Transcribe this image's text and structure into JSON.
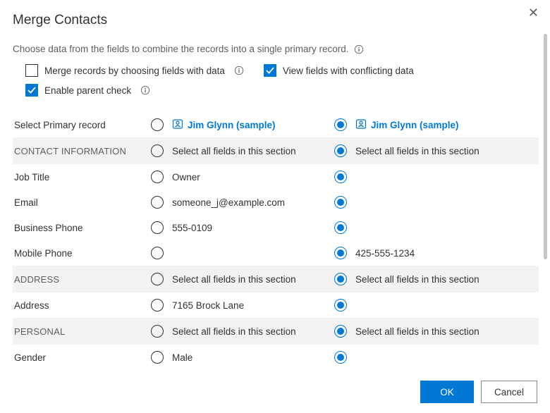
{
  "dialog": {
    "title": "Merge Contacts",
    "instruction": "Choose data from the fields to combine the records into a single primary record."
  },
  "options": {
    "mergeByFields": {
      "label": "Merge records by choosing fields with data",
      "checked": false
    },
    "viewConflicting": {
      "label": "View fields with conflicting data",
      "checked": true
    },
    "enableParent": {
      "label": "Enable parent check",
      "checked": true
    }
  },
  "primaryLabel": "Select Primary record",
  "recordA": {
    "name": "Jim Glynn (sample)",
    "selected": false
  },
  "recordB": {
    "name": "Jim Glynn (sample)",
    "selected": true
  },
  "sections": [
    {
      "title": "CONTACT INFORMATION",
      "selectAllLabel": "Select all fields in this section",
      "fields": [
        {
          "label": "Job Title",
          "a": "Owner",
          "b": "",
          "selected": "b"
        },
        {
          "label": "Email",
          "a": "someone_j@example.com",
          "b": "",
          "selected": "b"
        },
        {
          "label": "Business Phone",
          "a": "555-0109",
          "b": "",
          "selected": "b"
        },
        {
          "label": "Mobile Phone",
          "a": "",
          "b": "425-555-1234",
          "selected": "b"
        }
      ]
    },
    {
      "title": "ADDRESS",
      "selectAllLabel": "Select all fields in this section",
      "fields": [
        {
          "label": "Address",
          "a": "7165 Brock Lane",
          "b": "",
          "selected": "b"
        }
      ]
    },
    {
      "title": "PERSONAL",
      "selectAllLabel": "Select all fields in this section",
      "fields": [
        {
          "label": "Gender",
          "a": "Male",
          "b": "",
          "selected": "b"
        }
      ]
    }
  ],
  "buttons": {
    "ok": "OK",
    "cancel": "Cancel"
  }
}
